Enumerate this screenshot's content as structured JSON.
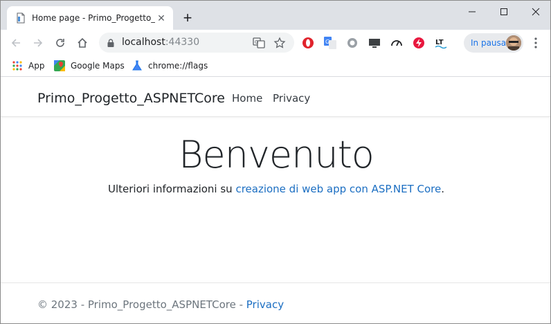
{
  "browser": {
    "tab_title": "Home page - Primo_Progetto_ASPNETCore",
    "new_tab_symbol": "+",
    "url_host": "localhost",
    "url_port": ":44330",
    "profile_label": "In pausa",
    "bookmarks": [
      "App",
      "Google Maps",
      "chrome://flags"
    ],
    "extension_icons": [
      "opera-red-icon",
      "translate-extension-icon",
      "grey-circle-icon",
      "monitor-icon",
      "speed-gauge-icon",
      "red-bolt-icon",
      "lt-icon"
    ],
    "accent_color": "#1a73e8"
  },
  "site": {
    "brand": "Primo_Progetto_ASPNETCore",
    "nav": [
      "Home",
      "Privacy"
    ],
    "hero_title": "Benvenuto",
    "hero_text_prefix": "Ulteriori informazioni su ",
    "hero_link": "creazione di web app con ASP.NET Core",
    "hero_text_suffix": ".",
    "footer_prefix": "© 2023 - Primo_Progetto_ASPNETCore - ",
    "footer_link": "Privacy",
    "link_color": "#1b6ec2"
  }
}
